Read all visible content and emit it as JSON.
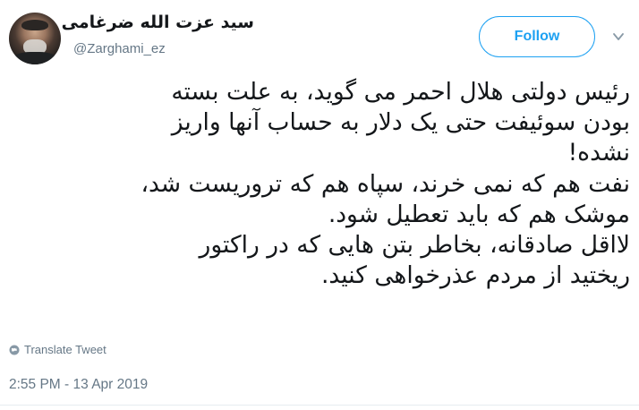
{
  "author": {
    "display_name": "سید عزت الله ضرغامی",
    "handle": "@Zarghami_ez"
  },
  "actions": {
    "follow_label": "Follow",
    "menu_icon": "chevron-down-icon"
  },
  "tweet": {
    "lines": [
      "رئیس دولتی هلال احمر می گوید، به علت بسته",
      "بودن سوئیفت حتی یک دلار به حساب آنها واریز",
      "نشده!",
      "نفت هم که نمی خرند، سپاه هم که تروریست شد،",
      "موشک هم که باید تعطیل شود.",
      "لااقل صادقانه، بخاطر بتن هایی که در راکتور",
      "ریختید از مردم عذرخواهی کنید."
    ]
  },
  "translate": {
    "label": "Translate Tweet",
    "icon": "globe-icon"
  },
  "meta": {
    "timestamp": "2:55 PM - 13 Apr 2019"
  },
  "colors": {
    "accent": "#1da1f2",
    "secondary_text": "#657786",
    "primary_text": "#14171a"
  }
}
